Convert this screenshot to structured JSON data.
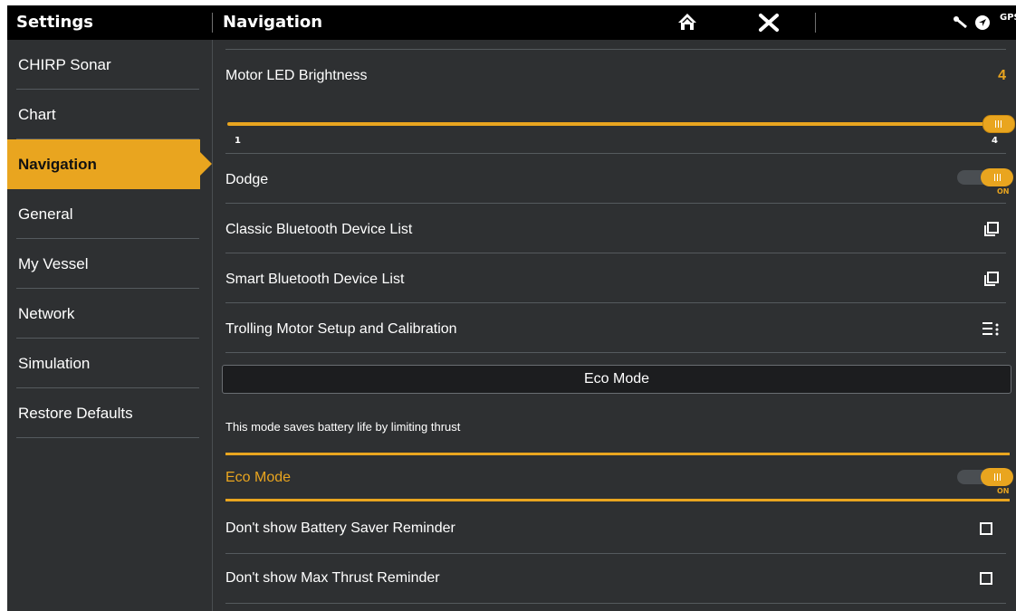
{
  "topbar": {
    "left_title": "Settings",
    "main_title": "Navigation",
    "home_icon": "home-icon",
    "close_icon": "close-icon",
    "gps_label": "GPS"
  },
  "sidebar": {
    "items": [
      {
        "label": "CHIRP Sonar",
        "active": false
      },
      {
        "label": "Chart",
        "active": false
      },
      {
        "label": "Navigation",
        "active": true
      },
      {
        "label": "General",
        "active": false
      },
      {
        "label": "My Vessel",
        "active": false
      },
      {
        "label": "Network",
        "active": false
      },
      {
        "label": "Simulation",
        "active": false
      },
      {
        "label": "Restore Defaults",
        "active": false
      }
    ]
  },
  "main": {
    "motor_led": {
      "label": "Motor LED Brightness",
      "value": "4",
      "slider_min": "1",
      "slider_max": "4"
    },
    "dodge": {
      "label": "Dodge",
      "state": "ON"
    },
    "classic_bt": {
      "label": "Classic Bluetooth Device List"
    },
    "smart_bt": {
      "label": "Smart Bluetooth Device List"
    },
    "trolling": {
      "label": "Trolling Motor Setup and Calibration"
    },
    "eco_section": {
      "header": "Eco Mode",
      "description": "This mode saves battery life by limiting thrust"
    },
    "eco_mode": {
      "label": "Eco Mode",
      "state": "ON"
    },
    "battery_reminder": {
      "label": "Don't show Battery Saver Reminder",
      "checked": false
    },
    "thrust_reminder": {
      "label": "Don't show Max Thrust Reminder",
      "checked": false
    }
  },
  "colors": {
    "accent": "#e9a51f",
    "background": "#2e3032",
    "topbar": "#000000"
  }
}
